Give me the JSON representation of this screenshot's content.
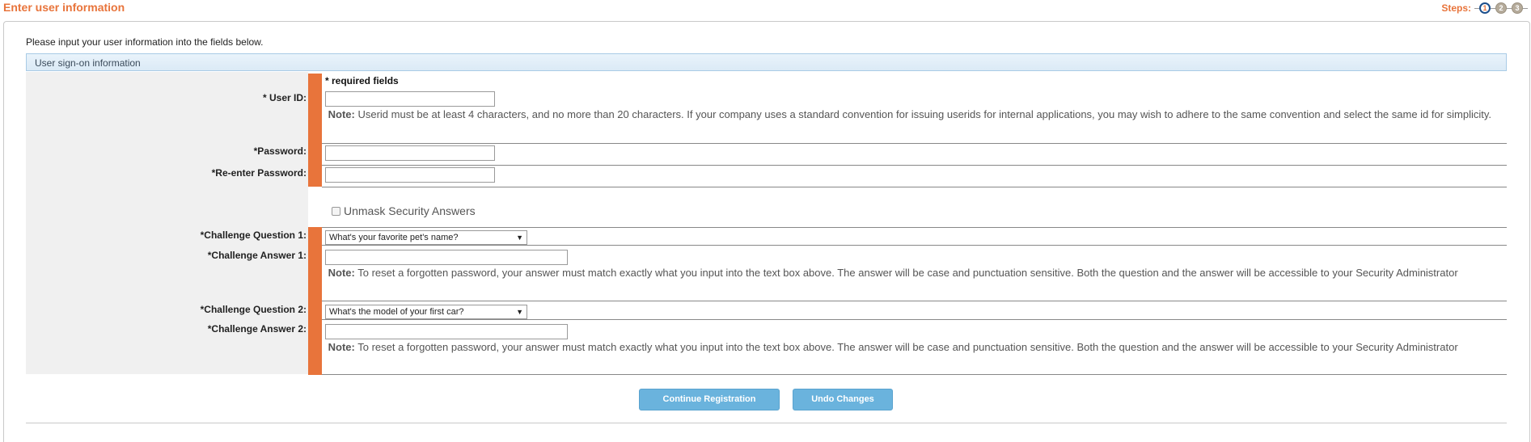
{
  "header": {
    "title": "Enter user information",
    "steps_label": "Steps:",
    "steps": [
      "1",
      "2",
      "3"
    ],
    "active_step": 1
  },
  "intro": "Please input your user information into the fields below.",
  "section_title": "User sign-on information",
  "required_note": "* required fields",
  "fields": {
    "user_id_label": "* User ID:",
    "user_id_value": "",
    "userid_note_bold": "Note:",
    "userid_note": " Userid must be at least 4 characters, and no more than 20 characters. If your company uses a standard convention for issuing userids for internal applications, you may wish to adhere to the same convention and select the same id for simplicity.",
    "password_label": "*Password:",
    "reenter_label": "*Re-enter Password:",
    "unmask_label": "Unmask Security Answers",
    "cq1_label": "*Challenge Question 1:",
    "cq1_value": "What's your favorite pet's name?",
    "ca1_label": "*Challenge Answer 1:",
    "ca_note_bold": "Note:",
    "ca_note": " To reset a forgotten password, your answer must match exactly what you input into the text box above. The answer will be case and punctuation sensitive. Both the question and the answer will be accessible to your Security Administrator",
    "cq2_label": "*Challenge Question 2:",
    "cq2_value": "What's the model of your first car?",
    "ca2_label": "*Challenge Answer 2:"
  },
  "buttons": {
    "continue": "Continue Registration",
    "undo": "Undo Changes"
  },
  "colors": {
    "accent": "#e8743b",
    "button": "#6ab3dd",
    "section_header": "#dbeaf6"
  }
}
